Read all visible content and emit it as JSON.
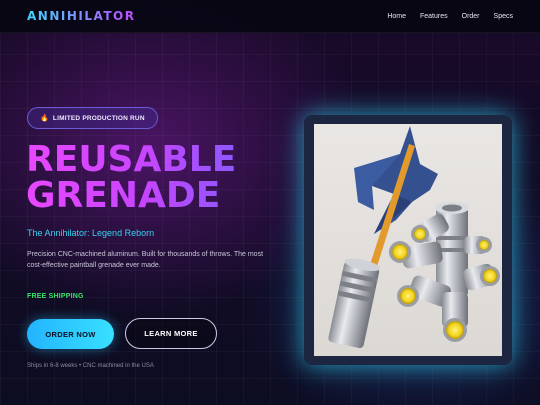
{
  "nav": {
    "brand": "ANNIHILATOR",
    "links": [
      "Home",
      "Features",
      "Order",
      "Specs"
    ]
  },
  "hero": {
    "badge": {
      "icon": "fire-icon",
      "text": "LIMITED PRODUCTION RUN"
    },
    "headline_line1": "REUSABLE",
    "headline_line2": "GRENADE",
    "subtitle": "The Annihilator: Legend Reborn",
    "description": "Precision CNC-machined aluminum. Built for thousands of throws. The most cost-effective paintball grenade ever made.",
    "shipping": "FREE SHIPPING",
    "order_button": "ORDER NOW",
    "learn_button": "LEARN MORE",
    "footnote": "Ships in 6-8 weeks • CNC machined in the USA"
  },
  "colors": {
    "brand_gradient_start": "#3fd6ff",
    "brand_gradient_end": "#c24bff",
    "headline": "#d94cff",
    "subtitle": "#36d2f2",
    "shipping": "#37e36a",
    "order_button": "#2ec8ff",
    "image_glow": "#32dcff"
  }
}
